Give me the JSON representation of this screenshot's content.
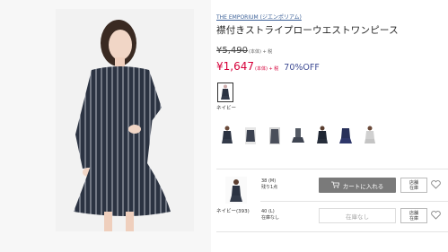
{
  "product": {
    "brand": "THE EMPORIUM (ジエンポリアム)",
    "title": "襟付きストライプローウエストワンピース",
    "original_price": "¥5,490",
    "original_tax": "(本体) + 税",
    "sale_price": "¥1,647",
    "sale_tax": "(本体) + 税",
    "discount": "70%OFF"
  },
  "colors": {
    "selected_label": "ネイビー",
    "thumbnail_count": 7
  },
  "variant": {
    "label": "ネイビー(393)",
    "sizes": [
      {
        "size": "38 (M)",
        "stock": "残り1点",
        "action": "カートに入れる",
        "store": [
          "店舗",
          "在庫"
        ]
      },
      {
        "size": "40 (L)",
        "stock": "在庫なし",
        "action": "在庫なし",
        "store": [
          "店舗",
          "在庫"
        ]
      }
    ]
  },
  "theme": {
    "sale_color": "#d6003a",
    "discount_color": "#3f4c94",
    "brand_link_color": "#3a5f97",
    "dress_color": "#2b3342"
  }
}
